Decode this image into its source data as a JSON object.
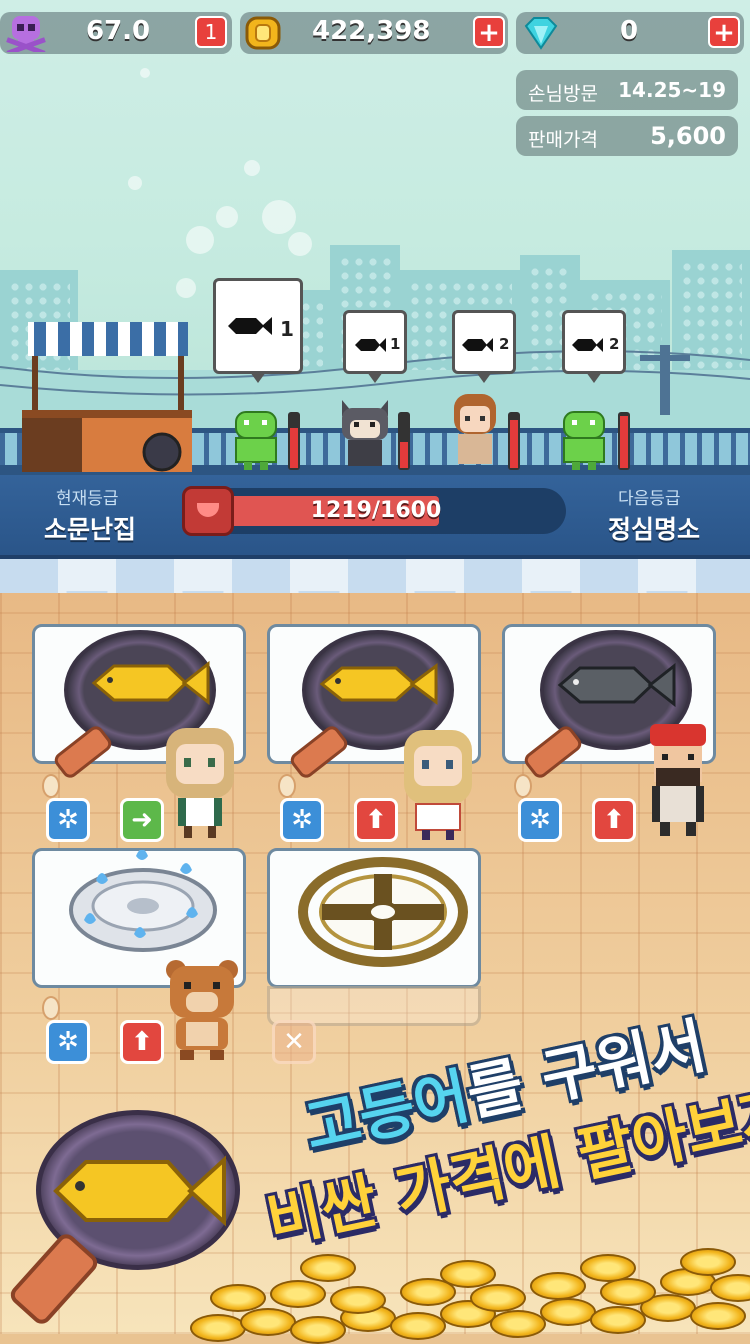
{
  "hud": {
    "skull_value": "67.0",
    "skull_badge": "1",
    "gold_value": "422,398",
    "gem_value": "0"
  },
  "info": {
    "visit_label": "손님방문",
    "visit_value": "14.25~19",
    "price_label": "판매가격",
    "price_value": "5,600"
  },
  "customers": [
    {
      "order": "1"
    },
    {
      "order": "1"
    },
    {
      "order": "2"
    },
    {
      "order": "2"
    }
  ],
  "grade": {
    "current_label": "현재등급",
    "current_name": "소문난집",
    "next_label": "다음등급",
    "next_name": "정심명소",
    "progress_text": "1219/1600",
    "progress_current": 1219,
    "progress_max": 1600
  },
  "stations": [
    {
      "fish": "golden mackerel",
      "buttons": [
        "gear",
        "go"
      ]
    },
    {
      "fish": "golden mackerel",
      "buttons": [
        "gear",
        "upgrade"
      ]
    },
    {
      "fish": "grey mackerel",
      "buttons": [
        "gear",
        "upgrade"
      ]
    },
    {
      "item": "gas burner",
      "buttons": [
        "gear",
        "upgrade"
      ]
    },
    {
      "item": "empty burner",
      "buttons": [
        "locked"
      ]
    }
  ],
  "promo": {
    "line1_highlight": "고등어",
    "line1_rest": "를 구워서",
    "line2": "비싼 가격에 팔아보자!"
  },
  "colors": {
    "accent_red": "#e8403c",
    "accent_blue": "#3c8fd8",
    "accent_green": "#5db84a",
    "grade_bar": "#2a5589",
    "gold": "#f2b51c"
  }
}
